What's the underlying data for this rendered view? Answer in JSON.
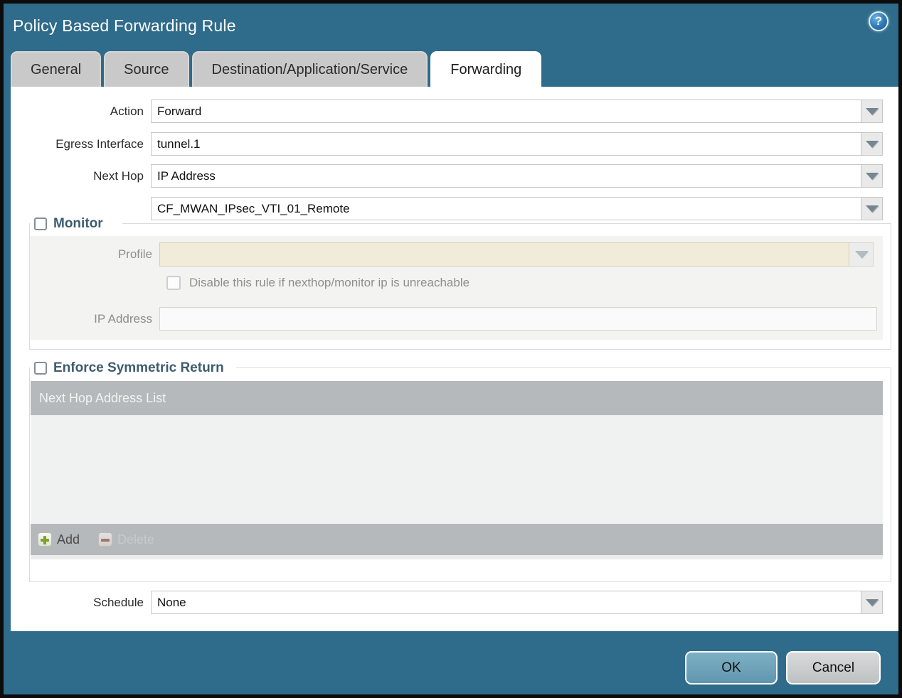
{
  "window": {
    "title": "Policy Based Forwarding Rule",
    "help_icon": "?"
  },
  "tabs": [
    {
      "label": "General",
      "active": false
    },
    {
      "label": "Source",
      "active": false
    },
    {
      "label": "Destination/Application/Service",
      "active": false
    },
    {
      "label": "Forwarding",
      "active": true
    }
  ],
  "form": {
    "action": {
      "label": "Action",
      "value": "Forward"
    },
    "egress_interface": {
      "label": "Egress Interface",
      "value": "tunnel.1"
    },
    "next_hop": {
      "label": "Next Hop",
      "value": "IP Address"
    },
    "next_hop_address": {
      "value": "CF_MWAN_IPsec_VTI_01_Remote"
    },
    "monitor": {
      "legend": "Monitor",
      "checked": false,
      "profile_label": "Profile",
      "profile_value": "",
      "disable_checkbox_label": "Disable this rule if nexthop/monitor ip is unreachable",
      "disable_checked": false,
      "ip_address_label": "IP Address",
      "ip_address_value": ""
    },
    "enforce_symmetric_return": {
      "legend": "Enforce Symmetric Return",
      "checked": false,
      "table_header": "Next Hop Address List",
      "rows": [],
      "add_label": "Add",
      "delete_label": "Delete",
      "delete_enabled": false
    },
    "schedule": {
      "label": "Schedule",
      "value": "None"
    }
  },
  "footer": {
    "ok_label": "OK",
    "cancel_label": "Cancel"
  },
  "colors": {
    "titlebar_teal": "#2f6b8a",
    "active_tab": "#ffffff",
    "inactive_tab": "#c9c9c9",
    "legend_text": "#3d5d6e",
    "disabled_field_beige": "#f1ebd9",
    "table_gray": "#b5b9bc",
    "ok_button_blue": "#6fa6bb",
    "cancel_button_gray": "#cbced0",
    "add_plus_green": "#7da227",
    "delete_minus_red": "#9c604f"
  }
}
